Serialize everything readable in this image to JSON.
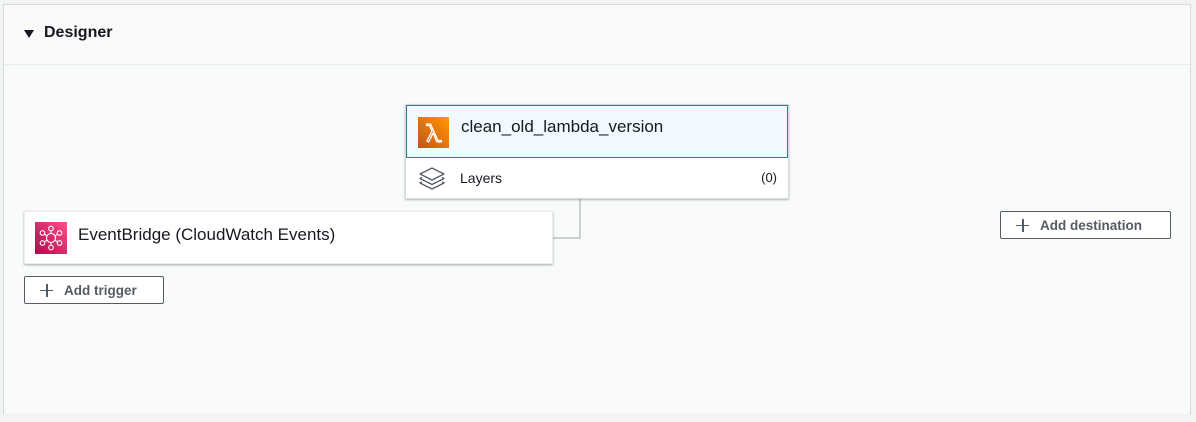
{
  "panel": {
    "title": "Designer"
  },
  "function": {
    "name": "clean_old_lambda_version",
    "icon": "lambda-icon",
    "layers_label": "Layers",
    "layers_count": "(0)"
  },
  "trigger": {
    "name": "EventBridge (CloudWatch Events)",
    "icon": "eventbridge-icon"
  },
  "buttons": {
    "add_trigger": "Add trigger",
    "add_destination": "Add destination"
  },
  "colors": {
    "lambda_orange": "#e47911",
    "eventbridge_pink": "#d6246e",
    "selected_border": "#2e7d8c",
    "selected_bg": "#f1faff"
  }
}
